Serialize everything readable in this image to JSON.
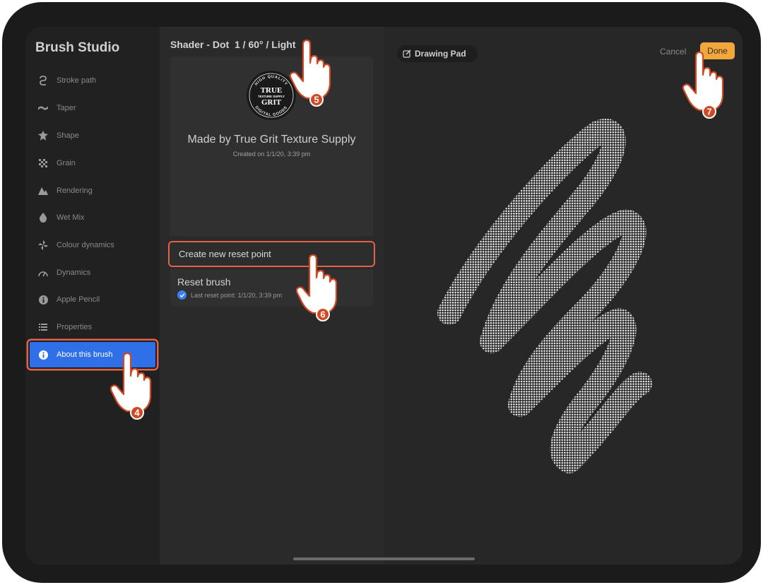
{
  "sidebar": {
    "title": "Brush Studio",
    "items": [
      {
        "label": "Stroke path",
        "icon": "stroke-path-icon"
      },
      {
        "label": "Taper",
        "icon": "taper-icon"
      },
      {
        "label": "Shape",
        "icon": "shape-icon"
      },
      {
        "label": "Grain",
        "icon": "grain-icon"
      },
      {
        "label": "Rendering",
        "icon": "rendering-icon"
      },
      {
        "label": "Wet Mix",
        "icon": "wet-mix-icon"
      },
      {
        "label": "Colour dynamics",
        "icon": "colour-dynamics-icon"
      },
      {
        "label": "Dynamics",
        "icon": "dynamics-icon"
      },
      {
        "label": "Apple Pencil",
        "icon": "apple-pencil-icon"
      },
      {
        "label": "Properties",
        "icon": "properties-icon"
      },
      {
        "label": "About this brush",
        "icon": "info-icon",
        "selected": true
      }
    ]
  },
  "middle": {
    "title": "Shader - Dot  1 / 60° / Light",
    "logo": {
      "top": "HIGH QUALITY",
      "line1": "TRUE",
      "line2": "TEXTURE SUPPLY",
      "line3": "GRIT",
      "bottom": "DIGITAL GOODS"
    },
    "made_by": "Made by True Grit Texture Supply",
    "created": "Created on 1/1/20, 3:39 pm",
    "reset_point_label": "Create new reset point",
    "reset_brush_label": "Reset brush",
    "last_reset": "Last reset point: 1/1/20, 3:39 pm"
  },
  "pad": {
    "drawing_pad_label": "Drawing Pad",
    "cancel_label": "Cancel",
    "done_label": "Done"
  },
  "steps": [
    "4",
    "5",
    "6",
    "7"
  ],
  "colors": {
    "accent_blue": "#2f6fe8",
    "highlight": "#e0634a",
    "done_button": "#f2a73c",
    "step_badge": "#cf4a24"
  }
}
